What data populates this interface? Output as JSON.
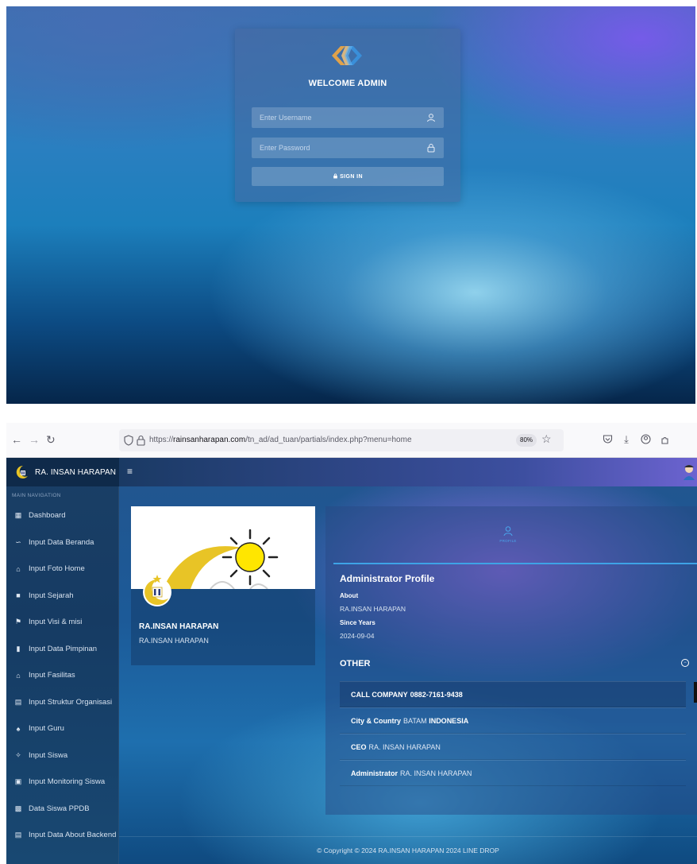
{
  "login": {
    "title": "WELCOME ADMIN",
    "username_placeholder": "Enter Username",
    "password_placeholder": "Enter Password",
    "signin_label": "SIGN IN",
    "icons": {
      "logo": "chain-link-logo-icon",
      "user": "user-icon",
      "lock": "lock-icon"
    }
  },
  "browser": {
    "url_prefix": "https://",
    "url_domain": "rainsanharapan.com",
    "url_path": "/tn_ad/ad_tuan/partials/index.php?menu=home",
    "zoom": "80%"
  },
  "app": {
    "brand_name": "RA. INSAN HARAPAN",
    "nav_header": "MAIN NAVIGATION",
    "nav_items": [
      {
        "label": "Dashboard",
        "icon": "dashboard-icon"
      },
      {
        "label": "Input Data Beranda",
        "icon": "link-icon"
      },
      {
        "label": "Input Foto Home",
        "icon": "home-icon"
      },
      {
        "label": "Input Sejarah",
        "icon": "square-icon"
      },
      {
        "label": "Input Visi & misi",
        "icon": "flag-icon"
      },
      {
        "label": "Input Data Pimpinan",
        "icon": "bookmark-icon"
      },
      {
        "label": "Input Fasilitas",
        "icon": "bank-icon"
      },
      {
        "label": "Input Struktur Organisasi",
        "icon": "list-box-icon"
      },
      {
        "label": "Input Guru",
        "icon": "users-icon"
      },
      {
        "label": "Input Siswa",
        "icon": "children-icon"
      },
      {
        "label": "Input Monitoring Siswa",
        "icon": "camera-icon"
      },
      {
        "label": "Data Siswa PPDB",
        "icon": "grid-icon"
      },
      {
        "label": "Input Data About Backend",
        "icon": "list-box-icon"
      }
    ],
    "profile": {
      "title": "RA.INSAN HARAPAN",
      "subtitle": "RA.INSAN HARAPAN"
    },
    "tab_label": "PROFILE",
    "admin": {
      "heading": "Administrator Profile",
      "about_label": "About",
      "about_value": "RA.INSAN HARAPAN",
      "since_label": "Since Years",
      "since_value": "2024-09-04"
    },
    "other": {
      "heading": "OTHER",
      "rows": [
        {
          "key": "CALL COMPANY",
          "value": "0882-7161-9438"
        },
        {
          "key": "City & Country",
          "value": "BATAM",
          "value_bold": "INDONESIA"
        },
        {
          "key": "CEO",
          "value": "RA. INSAN HARAPAN"
        },
        {
          "key": "Administrator",
          "value": "RA. INSAN HARAPAN"
        }
      ]
    },
    "footer": "© Copyright © 2024 RA.INSAN HARAPAN 2024 LINE DROP"
  }
}
